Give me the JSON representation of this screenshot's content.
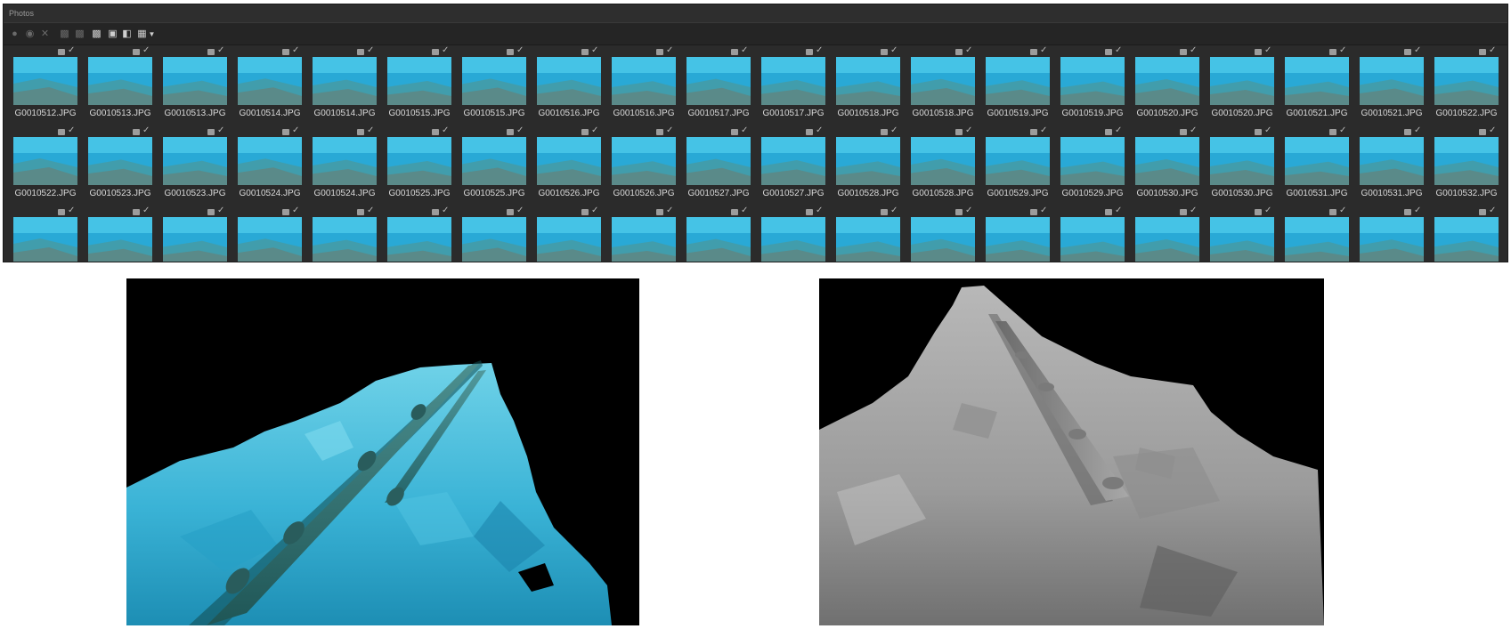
{
  "panel": {
    "title": "Photos"
  },
  "toolbar": {
    "icons": [
      "add-photo-icon",
      "remove-photo-icon",
      "close-icon",
      "align-left-icon",
      "align-right-icon",
      "mask-icon",
      "stop-icon",
      "copy-icon",
      "grid-view-icon",
      "dropdown-arrow-icon"
    ]
  },
  "thumbnails": {
    "rows": [
      [
        "G0010512.JPG",
        "G0010513.JPG",
        "G0010513.JPG",
        "G0010514.JPG",
        "G0010514.JPG",
        "G0010515.JPG",
        "G0010515.JPG",
        "G0010516.JPG",
        "G0010516.JPG",
        "G0010517.JPG",
        "G0010517.JPG",
        "G0010518.JPG",
        "G0010518.JPG",
        "G0010519.JPG",
        "G0010519.JPG",
        "G0010520.JPG",
        "G0010520.JPG",
        "G0010521.JPG",
        "G0010521.JPG",
        "G0010522.JPG"
      ],
      [
        "G0010522.JPG",
        "G0010523.JPG",
        "G0010523.JPG",
        "G0010524.JPG",
        "G0010524.JPG",
        "G0010525.JPG",
        "G0010525.JPG",
        "G0010526.JPG",
        "G0010526.JPG",
        "G0010527.JPG",
        "G0010527.JPG",
        "G0010528.JPG",
        "G0010528.JPG",
        "G0010529.JPG",
        "G0010529.JPG",
        "G0010530.JPG",
        "G0010530.JPG",
        "G0010531.JPG",
        "G0010531.JPG",
        "G0010532.JPG"
      ],
      [
        "",
        "",
        "",
        "",
        "",
        "",
        "",
        "",
        "",
        "",
        "",
        "",
        "",
        "",
        "",
        "",
        "",
        "",
        "",
        ""
      ]
    ]
  },
  "views": {
    "textured": {
      "background": "#000000",
      "surface_color": "#3fb6d6"
    },
    "mesh": {
      "background": "#000000",
      "surface_color": "#9a9a9a"
    }
  },
  "colors": {
    "panel_bg": "#2b2b2b",
    "label_text": "#d9d9d9",
    "water": "#29a9d6"
  }
}
